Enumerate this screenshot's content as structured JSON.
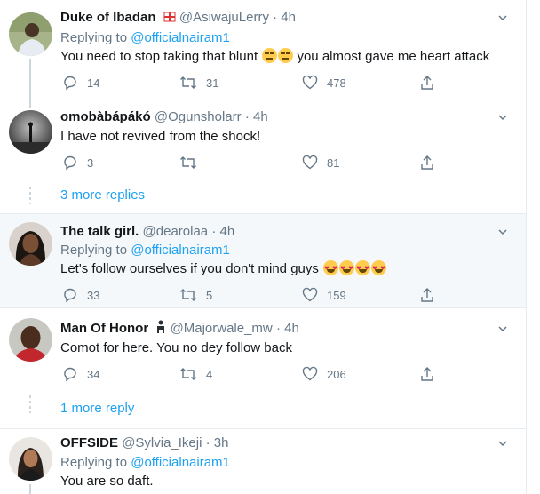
{
  "replying_label": "Replying to",
  "tweets": [
    {
      "name": "Duke of Ibadan",
      "handle": "@AsiwajuLerry",
      "time": "· 4h",
      "replying_to": "@officialnairam1",
      "text": "You need to stop taking that blunt",
      "text2": "you almost gave me heart attack",
      "replies": "14",
      "retweets": "31",
      "likes": "478"
    },
    {
      "name": "omobàbápákó",
      "handle": "@Ogunsholarr",
      "time": "· 4h",
      "text": "I have not revived from the shock!",
      "replies": "3",
      "retweets": "",
      "likes": "81"
    },
    {
      "name": "The talk girl.",
      "handle": "@dearolaa",
      "time": "· 4h",
      "replying_to": "@officialnairam1",
      "text": "Let's follow ourselves if you don't mind guys",
      "replies": "33",
      "retweets": "5",
      "likes": "159"
    },
    {
      "name": "Man Of Honor",
      "handle": "@Majorwale_mw",
      "time": "· 4h",
      "text": "Comot for here.  You no dey follow back",
      "replies": "34",
      "retweets": "4",
      "likes": "206"
    },
    {
      "name": "OFFSIDE",
      "handle": "@Sylvia_Ikeji",
      "time": "· 3h",
      "replying_to": "@officialnairam1",
      "text": "You are so daft."
    }
  ],
  "more_replies_1": "3 more replies",
  "more_replies_2": "1 more reply",
  "icons": {
    "reply": "reply-icon",
    "retweet": "retweet-icon",
    "like": "heart-icon",
    "share": "share-icon",
    "caret": "chevron-down-icon"
  },
  "colors": {
    "link": "#1da1f2",
    "secondary": "#657786",
    "highlight_bg": "#f5f8fa"
  }
}
